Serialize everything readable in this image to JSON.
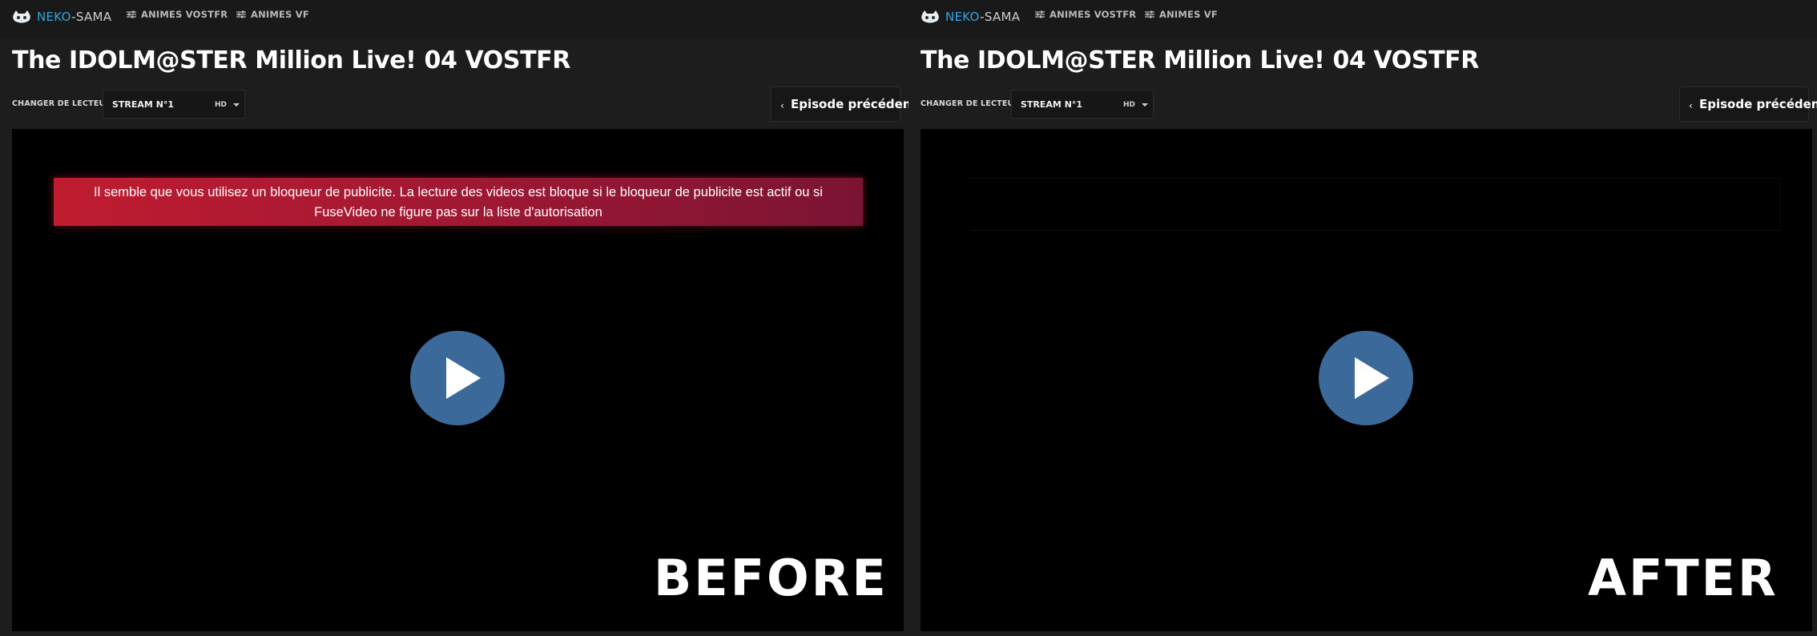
{
  "colors": {
    "accent": "#2ea6e0",
    "alert_start": "#c01c30",
    "alert_end": "#7a1433",
    "play_button": "#3b6a9a"
  },
  "panels": [
    {
      "logo_prefix": "NEKO",
      "logo_suffix": "-SAMA",
      "nav": [
        "ANIMES VOSTFR",
        "ANIMES VF"
      ],
      "title": "The IDOLM@STER Million Live! 04 VOSTFR",
      "player_label": "CHANGER DE LECTEUR",
      "stream_value": "STREAM N°1",
      "quality": "HD",
      "prev_episode": "Episode précédent",
      "alert": "Il semble que vous utilisez un bloqueur de publicite. La lecture des videos est bloque si le bloqueur de publicite est actif ou si FuseVideo ne figure pas sur la liste d'autorisation",
      "stamp": "BEFORE"
    },
    {
      "logo_prefix": "NEKO",
      "logo_suffix": "-SAMA",
      "nav": [
        "ANIMES VOSTFR",
        "ANIMES VF"
      ],
      "title": "The IDOLM@STER Million Live! 04 VOSTFR",
      "player_label": "CHANGER DE LECTEUR",
      "stream_value": "STREAM N°1",
      "quality": "HD",
      "prev_episode": "Episode précédent",
      "stamp": "AFTER"
    }
  ]
}
